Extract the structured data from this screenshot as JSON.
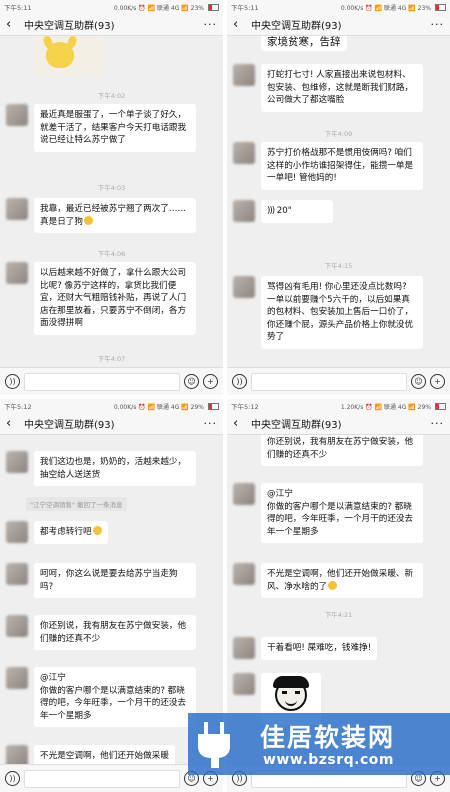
{
  "panels": [
    {
      "status": {
        "time": "下午5:11",
        "right": "0.00K/s ⏰ 📶 联通 4G 📶 23%"
      },
      "title": "中央空调互助群(93)",
      "items": [
        {
          "kind": "ts",
          "text": "下午4:02"
        },
        {
          "kind": "msg",
          "text": "最近真是服蛋了，一个单子谈了好久，就差干活了，结果客户今天打电话跟我说已经让特么苏宁做了"
        },
        {
          "kind": "ts",
          "text": "下午4:03"
        },
        {
          "kind": "msg",
          "text": "我靠，最近已经被苏宁翘了两次了……真是日了狗"
        },
        {
          "kind": "ts",
          "text": "下午4:06"
        },
        {
          "kind": "msg",
          "text": "以后越来越不好做了，拿什么跟大公司比呢? 像苏宁这样的，拿货比我们便宜，还财大气粗赔钱补贴，再说了人门店在那里放着，只要苏宁不倒闭，各方面没得拼啊"
        },
        {
          "kind": "ts",
          "text": "下午4:07"
        }
      ]
    },
    {
      "status": {
        "time": "下午5:11",
        "right": "0.00K/s ⏰ 📶 联通 4G 📶 23%"
      },
      "title": "中央空调互助群(93)",
      "items": [
        {
          "kind": "msg",
          "text": "家境贫寒，告辞"
        },
        {
          "kind": "msg",
          "text": "打蛇打七寸! 人家直接出来说包材料、包安装、包维修，这就是断我们财路，公司做大了都这嘴脸"
        },
        {
          "kind": "ts",
          "text": "下午4:09"
        },
        {
          "kind": "msg",
          "text": "苏宁打价格战那不是惯用伎俩吗? 咱们这样的小作坊谁招架得住，能攒一单是一单吧! 管他妈的!"
        },
        {
          "kind": "voice",
          "text": "20\""
        },
        {
          "kind": "ts",
          "text": "下午4:15"
        },
        {
          "kind": "msg",
          "text": "骂得凶有毛用! 你心里还没点比数吗? 一单以前要赚个5六千的，以后如果真的包材料、包安装加上售后一口价了，你还赚个屁，源头产品价格上你就没优势了"
        }
      ]
    },
    {
      "status": {
        "time": "下午5:12",
        "right": "0.00K/s ⏰ 📶 联通 4G 📶 29%"
      },
      "title": "中央空调互助群(93)",
      "items": [
        {
          "kind": "msg",
          "text": "我们这边也是，奶奶的，活越来越少，抽空给人送送货"
        },
        {
          "kind": "note",
          "text": "\"江宁空调销售\" 撤回了一条消息"
        },
        {
          "kind": "msg",
          "text": "都考虑转行吧"
        },
        {
          "kind": "msg",
          "text": "呵呵，你这么说是要去给苏宁当走狗吗?"
        },
        {
          "kind": "msg",
          "text": "你还别说，我有朋友在苏宁做安装，他们赚的还真不少"
        },
        {
          "kind": "msg",
          "text": "@江宁\n你做的客户哪个是以满意结束的? 都晓得的吧，今年旺季，一个月干的还没去年一个星期多"
        },
        {
          "kind": "msg",
          "text": "不光是空调啊，他们还开始做采暖"
        }
      ]
    },
    {
      "status": {
        "time": "下午5:12",
        "right": "1.20K/s ⏰ 📶 联通 4G 📶 29%"
      },
      "title": "中央空调互助群(93)",
      "items": [
        {
          "kind": "msg",
          "text": "你还别说，我有朋友在苏宁做安装，他们赚的还真不少"
        },
        {
          "kind": "msg",
          "text": "@江宁\n你做的客户哪个是以满意结束的? 都晓得的吧，今年旺季，一个月干的还没去年一个星期多"
        },
        {
          "kind": "msg",
          "text": "不光是空调啊，他们还开始做采暖、新风、净水啥的了"
        },
        {
          "kind": "ts",
          "text": "下午4:21"
        },
        {
          "kind": "msg",
          "text": "干着看吧! 屎难吃，钱难挣!"
        }
      ]
    }
  ],
  "watermark": {
    "title": "佳居软装网",
    "url": "www.bzsrq.com",
    "color": "#2a6ec8"
  }
}
